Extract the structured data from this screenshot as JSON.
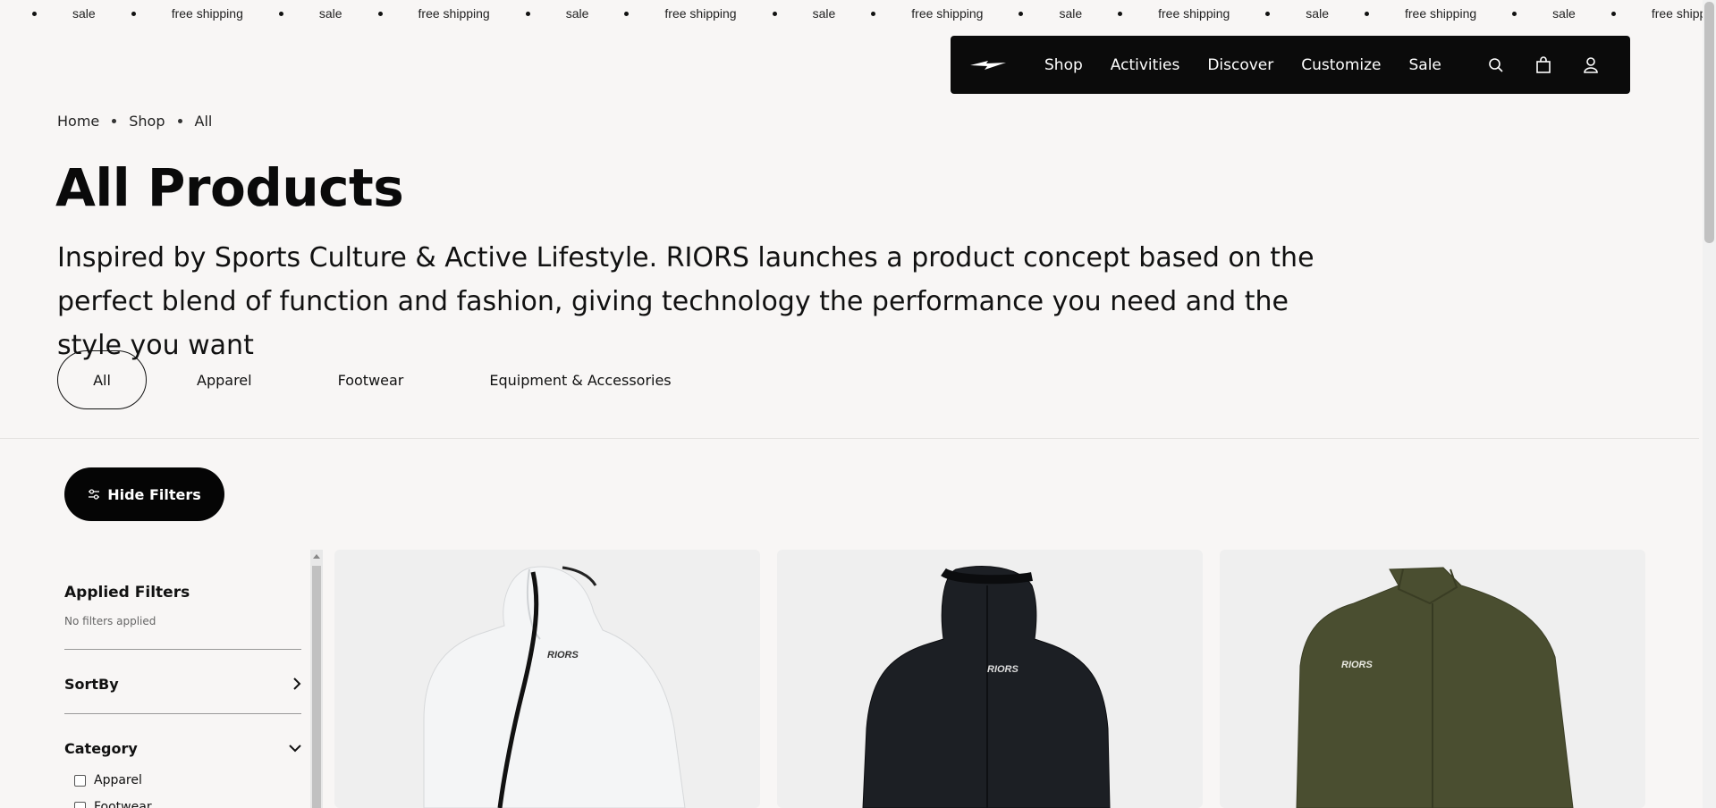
{
  "marquee": {
    "items": [
      "sale",
      "free shipping",
      "sale",
      "free shipping",
      "sale",
      "free shipping",
      "sale",
      "free shipping",
      "sale",
      "free shipping",
      "sale",
      "free shipping",
      "sale",
      "free shipping",
      "sale",
      "free shipping",
      "sale",
      "free shipping"
    ]
  },
  "nav": {
    "logo_icon": "lightning-bolt-logo",
    "links": [
      "Shop",
      "Activities",
      "Discover",
      "Customize",
      "Sale"
    ],
    "icons": [
      "search-icon",
      "bag-icon",
      "user-icon"
    ]
  },
  "breadcrumb": [
    "Home",
    "Shop",
    "All"
  ],
  "page": {
    "title": "All Products",
    "description": "Inspired by Sports Culture & Active Lifestyle. RIORS launches a product concept based on the perfect blend of function and fashion, giving technology the performance you need and the style you want"
  },
  "tabs": [
    "All",
    "Apparel",
    "Footwear",
    "Equipment & Accessories"
  ],
  "active_tab": "All",
  "filters": {
    "toggle_label": "Hide Filters",
    "applied_title": "Applied Filters",
    "applied_empty": "No filters applied",
    "sort_label": "SortBy",
    "category_label": "Category",
    "category_options": [
      "Apparel",
      "Footwear"
    ]
  },
  "products": [
    {
      "brand": "RIORS",
      "color": "#f4f5f6"
    },
    {
      "brand": "RIORS",
      "color": "#1c1f24"
    },
    {
      "brand": "RIORS",
      "color": "#4a4e30"
    }
  ],
  "colors": {
    "background": "#f8f6f5",
    "nav_bg": "#0b0b0b",
    "button_bg": "#050505",
    "card_bg": "#efefef"
  }
}
